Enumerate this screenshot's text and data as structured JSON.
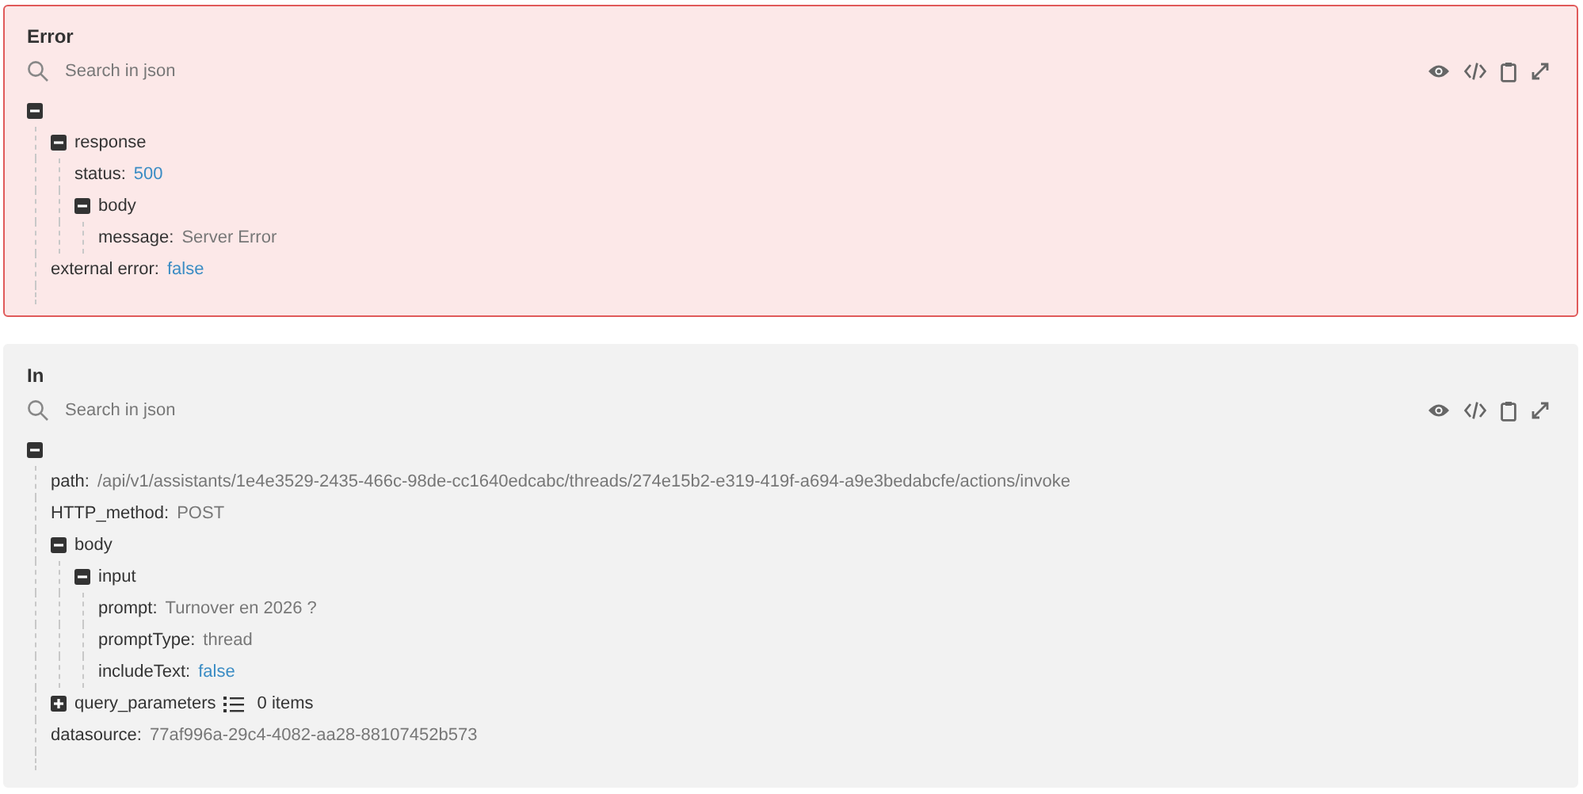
{
  "panels": [
    {
      "kind": "error",
      "title": "Error",
      "search": {
        "placeholder": "Search in json"
      },
      "tree": {
        "kind": "object",
        "expanded": true,
        "children": [
          {
            "kind": "object",
            "key": "response",
            "expanded": true,
            "children": [
              {
                "kind": "literal",
                "key": "status:",
                "value": "500"
              },
              {
                "kind": "object",
                "key": "body",
                "expanded": true,
                "children": [
                  {
                    "kind": "text",
                    "key": "message:",
                    "value": "Server Error"
                  }
                ]
              }
            ]
          },
          {
            "kind": "literal",
            "key": "external error:",
            "value": "false"
          }
        ]
      }
    },
    {
      "kind": "normal",
      "title": "In",
      "search": {
        "placeholder": "Search in json"
      },
      "tree": {
        "kind": "object",
        "expanded": true,
        "children": [
          {
            "kind": "text",
            "key": "path:",
            "value": "/api/v1/assistants/1e4e3529-2435-466c-98de-cc1640edcabc/threads/274e15b2-e319-419f-a694-a9e3bedabcfe/actions/invoke"
          },
          {
            "kind": "text",
            "key": "HTTP_method:",
            "value": "POST"
          },
          {
            "kind": "object",
            "key": "body",
            "expanded": true,
            "children": [
              {
                "kind": "object",
                "key": "input",
                "expanded": true,
                "children": [
                  {
                    "kind": "text",
                    "key": "prompt:",
                    "value": "Turnover en 2026 ?"
                  },
                  {
                    "kind": "text",
                    "key": "promptType:",
                    "value": "thread"
                  },
                  {
                    "kind": "literal",
                    "key": "includeText:",
                    "value": "false"
                  }
                ]
              }
            ]
          },
          {
            "kind": "object",
            "key": "query_parameters",
            "expanded": false,
            "count": "0 items"
          },
          {
            "kind": "text",
            "key": "datasource:",
            "value": "77af996a-29c4-4082-aa28-88107452b573"
          }
        ]
      }
    }
  ]
}
